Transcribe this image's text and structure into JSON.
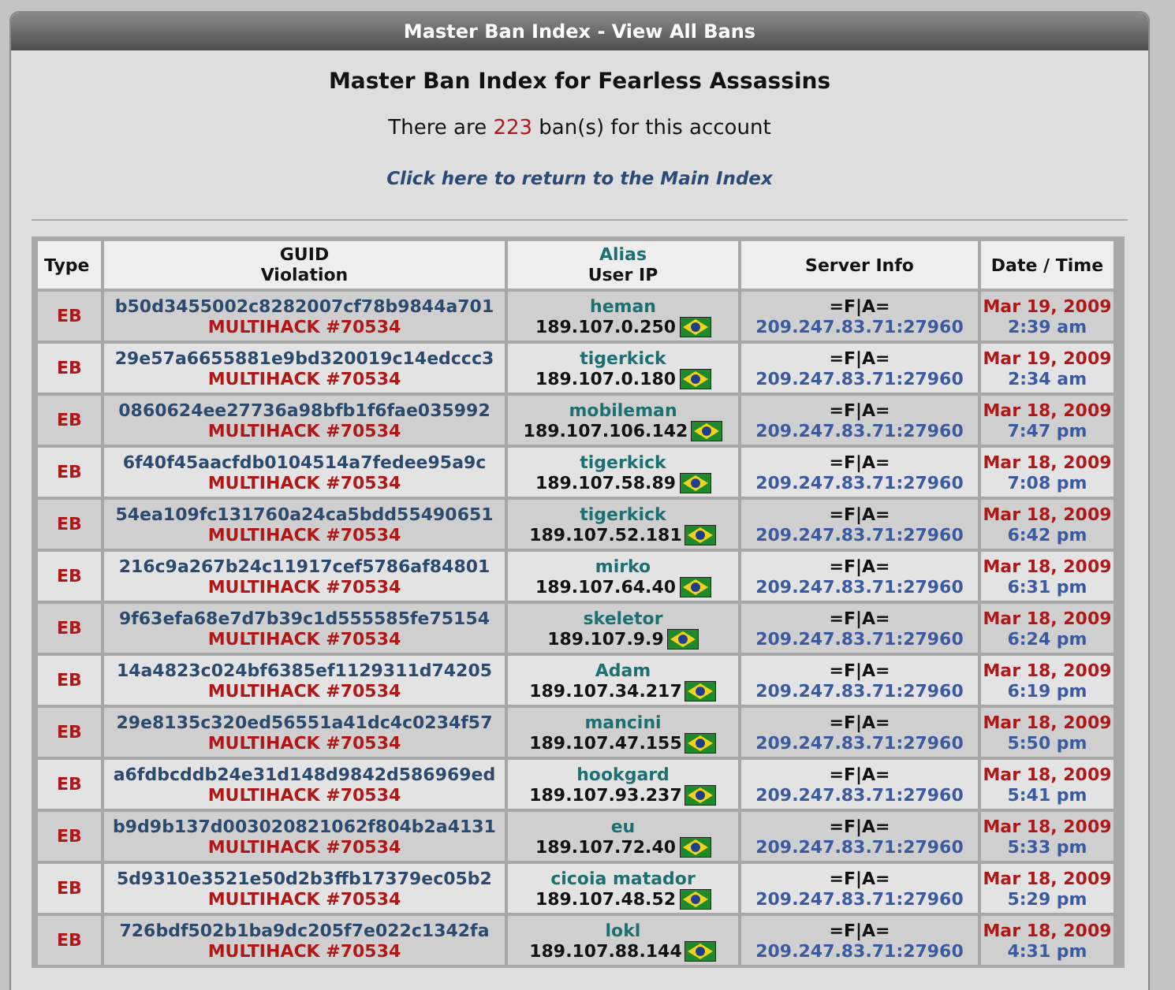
{
  "window": {
    "title": "Master Ban Index - View All Bans"
  },
  "heading": "Master Ban Index for Fearless Assassins",
  "summary": {
    "before": "There are",
    "count": "223",
    "after": "ban(s) for this account"
  },
  "link": "Click here to return to the Main Index",
  "table": {
    "columns": [
      {
        "lines": [
          "Type"
        ]
      },
      {
        "lines": [
          "GUID",
          "Violation"
        ]
      },
      {
        "lines": [
          "Alias",
          "User IP"
        ]
      },
      {
        "lines": [
          "Server Info"
        ]
      },
      {
        "lines": [
          "Date / Time"
        ]
      }
    ],
    "rows": [
      {
        "type": "EB",
        "guid": "b50d3455002c8282007cf78b9844a701",
        "violation": "MULTIHACK #70534",
        "alias": "heman",
        "ip": "189.107.0.250",
        "server": "=F|A=",
        "address": "209.247.83.71:27960",
        "date": "Mar 19, 2009",
        "time": "2:39 am"
      },
      {
        "type": "EB",
        "guid": "29e57a6655881e9bd320019c14edccc3",
        "violation": "MULTIHACK #70534",
        "alias": "tigerkick",
        "ip": "189.107.0.180",
        "server": "=F|A=",
        "address": "209.247.83.71:27960",
        "date": "Mar 19, 2009",
        "time": "2:34 am"
      },
      {
        "type": "EB",
        "guid": "0860624ee27736a98bfb1f6fae035992",
        "violation": "MULTIHACK #70534",
        "alias": "mobileman",
        "ip": "189.107.106.142",
        "server": "=F|A=",
        "address": "209.247.83.71:27960",
        "date": "Mar 18, 2009",
        "time": "7:47 pm"
      },
      {
        "type": "EB",
        "guid": "6f40f45aacfdb0104514a7fedee95a9c",
        "violation": "MULTIHACK #70534",
        "alias": "tigerkick",
        "ip": "189.107.58.89",
        "server": "=F|A=",
        "address": "209.247.83.71:27960",
        "date": "Mar 18, 2009",
        "time": "7:08 pm"
      },
      {
        "type": "EB",
        "guid": "54ea109fc131760a24ca5bdd55490651",
        "violation": "MULTIHACK #70534",
        "alias": "tigerkick",
        "ip": "189.107.52.181",
        "server": "=F|A=",
        "address": "209.247.83.71:27960",
        "date": "Mar 18, 2009",
        "time": "6:42 pm"
      },
      {
        "type": "EB",
        "guid": "216c9a267b24c11917cef5786af84801",
        "violation": "MULTIHACK #70534",
        "alias": "mirko",
        "ip": "189.107.64.40",
        "server": "=F|A=",
        "address": "209.247.83.71:27960",
        "date": "Mar 18, 2009",
        "time": "6:31 pm"
      },
      {
        "type": "EB",
        "guid": "9f63efa68e7d7b39c1d555585fe75154",
        "violation": "MULTIHACK #70534",
        "alias": "skeletor",
        "ip": "189.107.9.9",
        "server": "=F|A=",
        "address": "209.247.83.71:27960",
        "date": "Mar 18, 2009",
        "time": "6:24 pm"
      },
      {
        "type": "EB",
        "guid": "14a4823c024bf6385ef1129311d74205",
        "violation": "MULTIHACK #70534",
        "alias": "Adam",
        "ip": "189.107.34.217",
        "server": "=F|A=",
        "address": "209.247.83.71:27960",
        "date": "Mar 18, 2009",
        "time": "6:19 pm"
      },
      {
        "type": "EB",
        "guid": "29e8135c320ed56551a41dc4c0234f57",
        "violation": "MULTIHACK #70534",
        "alias": "mancini",
        "ip": "189.107.47.155",
        "server": "=F|A=",
        "address": "209.247.83.71:27960",
        "date": "Mar 18, 2009",
        "time": "5:50 pm"
      },
      {
        "type": "EB",
        "guid": "a6fdbcddb24e31d148d9842d586969ed",
        "violation": "MULTIHACK #70534",
        "alias": "hookgard",
        "ip": "189.107.93.237",
        "server": "=F|A=",
        "address": "209.247.83.71:27960",
        "date": "Mar 18, 2009",
        "time": "5:41 pm"
      },
      {
        "type": "EB",
        "guid": "b9d9b137d003020821062f804b2a4131",
        "violation": "MULTIHACK #70534",
        "alias": "eu",
        "ip": "189.107.72.40",
        "server": "=F|A=",
        "address": "209.247.83.71:27960",
        "date": "Mar 18, 2009",
        "time": "5:33 pm"
      },
      {
        "type": "EB",
        "guid": "5d9310e3521e50d2b3ffb17379ec05b2",
        "violation": "MULTIHACK #70534",
        "alias": "cicoia matador",
        "ip": "189.107.48.52",
        "server": "=F|A=",
        "address": "209.247.83.71:27960",
        "date": "Mar 18, 2009",
        "time": "5:29 pm"
      },
      {
        "type": "EB",
        "guid": "726bdf502b1ba9dc205f7e022c1342fa",
        "violation": "MULTIHACK #70534",
        "alias": "lokl",
        "ip": "189.107.88.144",
        "server": "=F|A=",
        "address": "209.247.83.71:27960",
        "date": "Mar 18, 2009",
        "time": "4:31 pm"
      }
    ]
  }
}
